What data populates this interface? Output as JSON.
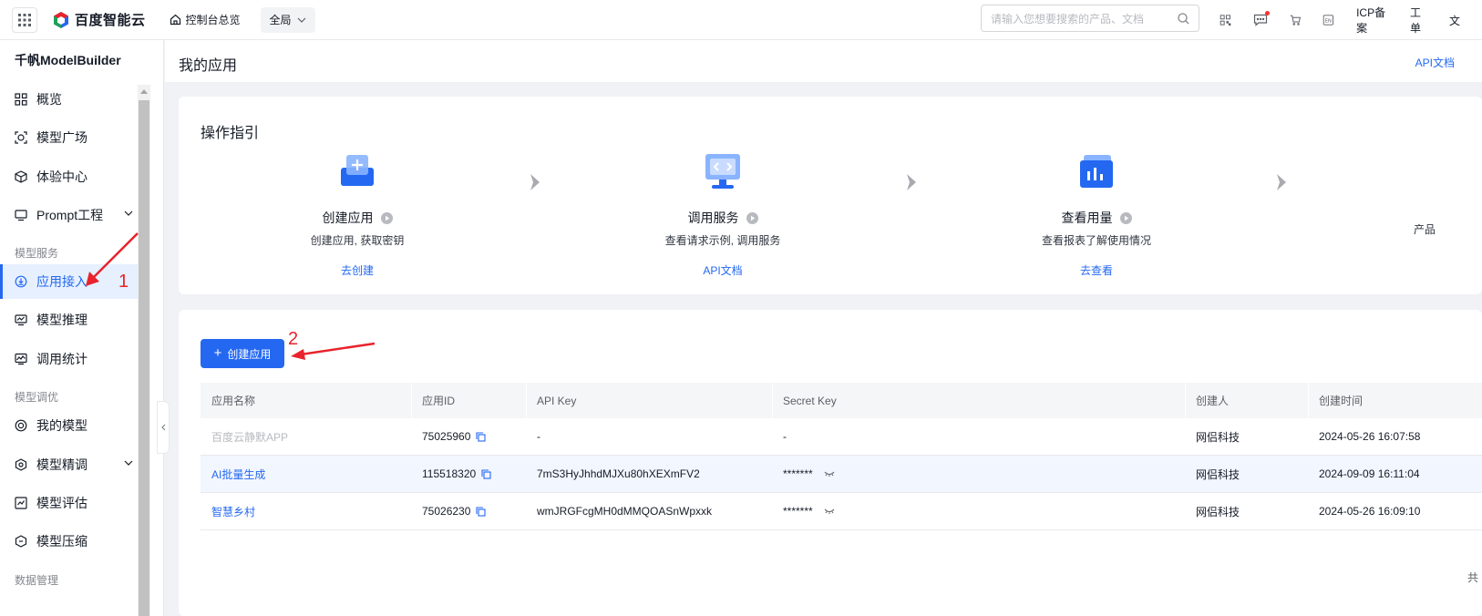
{
  "topbar": {
    "brand": "百度智能云",
    "console": "控制台总览",
    "region": "全局",
    "search_placeholder": "请输入您想要搜索的产品、文档",
    "links": [
      "ICP备案",
      "工单",
      "文"
    ]
  },
  "sidebar": {
    "title": "千帆ModelBuilder",
    "items": [
      {
        "label": "概览",
        "icon": "grid-icon"
      },
      {
        "label": "模型广场",
        "icon": "model-square-icon"
      },
      {
        "label": "体验中心",
        "icon": "cube-icon"
      },
      {
        "label": "Prompt工程",
        "icon": "prompt-icon"
      },
      {
        "label": "应用接入",
        "icon": "app-access-icon"
      },
      {
        "label": "模型推理",
        "icon": "inference-icon"
      },
      {
        "label": "调用统计",
        "icon": "stats-icon"
      },
      {
        "label": "我的模型",
        "icon": "my-model-icon"
      },
      {
        "label": "模型精调",
        "icon": "tune-icon"
      },
      {
        "label": "模型评估",
        "icon": "evaluate-icon"
      },
      {
        "label": "模型压缩",
        "icon": "compress-icon"
      }
    ],
    "groups": [
      "模型服务",
      "模型调优",
      "数据管理"
    ]
  },
  "page": {
    "title": "我的应用",
    "api_doc": "API文档"
  },
  "guide": {
    "title": "操作指引",
    "steps": [
      {
        "name": "创建应用",
        "desc": "创建应用, 获取密钥",
        "link": "去创建"
      },
      {
        "name": "调用服务",
        "desc": "查看请求示例, 调用服务",
        "link": "API文档"
      },
      {
        "name": "查看用量",
        "desc": "查看报表了解使用情况",
        "link": "去查看"
      }
    ],
    "partial": "产品"
  },
  "table": {
    "create_button": "创建应用",
    "headers": [
      "应用名称",
      "应用ID",
      "API Key",
      "Secret Key",
      "创建人",
      "创建时间"
    ],
    "rows": [
      {
        "name": "百度云静默APP",
        "id": "75025960",
        "api_key": "-",
        "secret": "-",
        "creator": "网侣科技",
        "time": "2024-05-26 16:07:58"
      },
      {
        "name": "AI批量生成",
        "id": "115518320",
        "api_key": "7mS3HyJhhdMJXu80hXEXmFV2",
        "secret": "*******",
        "creator": "网侣科技",
        "time": "2024-09-09 16:11:04"
      },
      {
        "name": "智慧乡村",
        "id": "75026230",
        "api_key": "wmJRGFcgMH0dMMQOASnWpxxk",
        "secret": "*******",
        "creator": "网侣科技",
        "time": "2024-05-26 16:09:10"
      }
    ],
    "total": "共"
  },
  "annotations": {
    "n1": "1",
    "n2": "2"
  },
  "colors": {
    "primary": "#2468f2",
    "annotation": "#e8232b"
  }
}
